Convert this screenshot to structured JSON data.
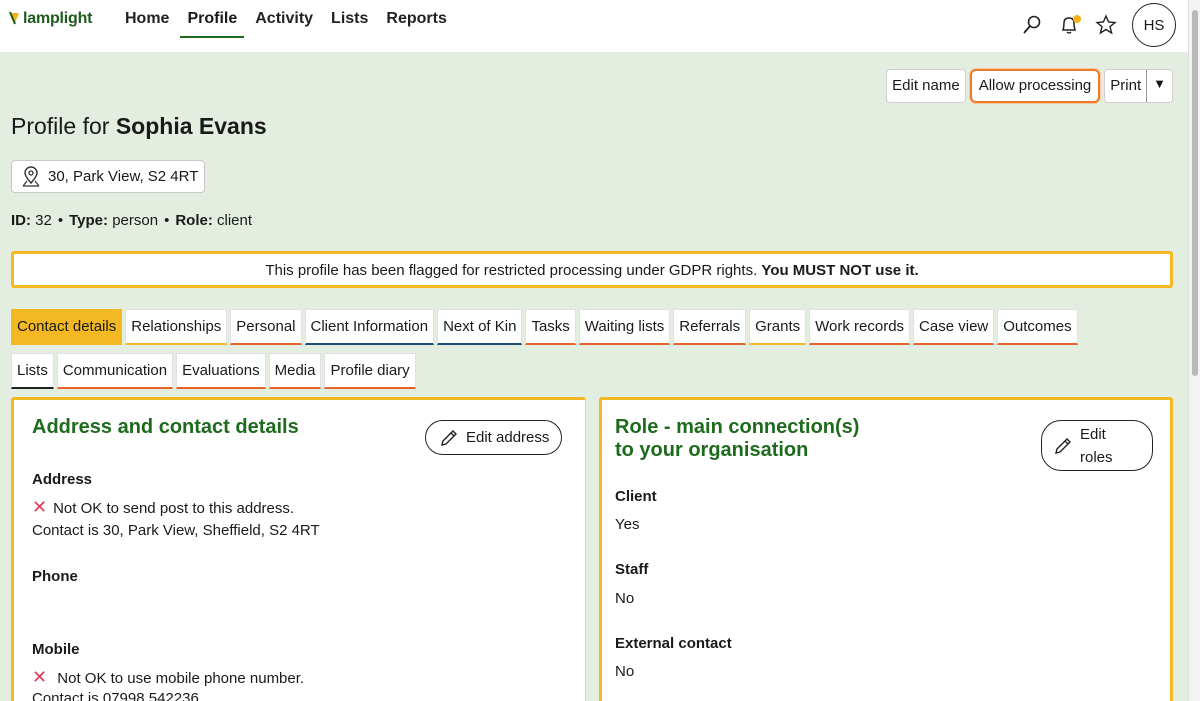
{
  "brand": {
    "name": "lamplight"
  },
  "nav": {
    "items": [
      "Home",
      "Profile",
      "Activity",
      "Lists",
      "Reports"
    ],
    "active": "Profile"
  },
  "header_icons": [
    "search-icon",
    "bell-icon",
    "star-icon"
  ],
  "user": {
    "initials": "HS"
  },
  "actions": {
    "edit_name": "Edit name",
    "allow_processing": "Allow processing",
    "print": "Print",
    "print_arrow": "▼"
  },
  "profile": {
    "title_prefix": "Profile for",
    "name": "Sophia Evans",
    "address_chip": "30, Park View, S2 4RT",
    "id_label": "ID:",
    "id": "32",
    "type_label": "Type:",
    "type": "person",
    "role_label": "Role:",
    "role": "client"
  },
  "gdpr": {
    "text": "This profile has been flagged for restricted processing under GDPR rights.",
    "strong": "You MUST NOT use it."
  },
  "tabs": {
    "row1": [
      "Contact details",
      "Relationships",
      "Personal",
      "Client Information",
      "Next of Kin",
      "Tasks",
      "Waiting lists",
      "Referrals",
      "Grants",
      "Work records",
      "Case view",
      "Outcomes"
    ],
    "row2": [
      "Lists",
      "Communication",
      "Evaluations",
      "Media",
      "Profile diary"
    ],
    "active": "Contact details"
  },
  "contact": {
    "heading": "Address and contact details",
    "edit_label": "Edit address",
    "address_label": "Address",
    "address_warning": "Not OK to send post to this address.",
    "address_contact": "Contact is 30, Park View, Sheffield, S2 4RT",
    "phone_label": "Phone",
    "mobile_label": "Mobile",
    "mobile_warning": "Not OK to use mobile phone number.",
    "mobile_contact": "Contact is 07998 542236",
    "warn_mark": "✕"
  },
  "roles": {
    "heading_line1": "Role - main connection(s)",
    "heading_line2": "to your organisation",
    "edit_line1": "Edit",
    "edit_line2": "roles",
    "client_label": "Client",
    "client_value": "Yes",
    "staff_label": "Staff",
    "staff_value": "No",
    "external_label": "External contact",
    "external_value": "No"
  },
  "colors": {
    "brand_green": "#1e6b1e",
    "accent_yellow": "#f4b822",
    "accent_orange": "#e8632a",
    "warning_red": "#e23a5c",
    "page_bg": "#e3eee1"
  }
}
